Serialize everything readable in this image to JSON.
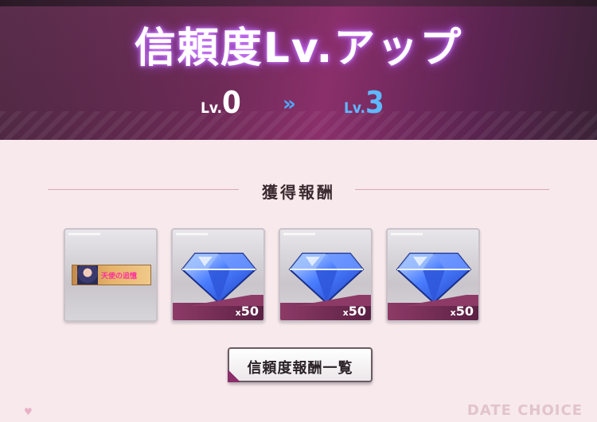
{
  "header": {
    "title": "信頼度Lv.アップ",
    "level_from_prefix": "Lv.",
    "level_from_value": "0",
    "level_to_prefix": "Lv.",
    "level_to_value": "3",
    "arrow_glyph": "»"
  },
  "rewards": {
    "section_title": "獲得報酬",
    "items": [
      {
        "type": "title-card",
        "icon": "title-card-icon",
        "card_text": "天使の追憶"
      },
      {
        "type": "gem",
        "icon": "spirit-gem-icon",
        "qty_prefix": "x",
        "qty": "50"
      },
      {
        "type": "gem",
        "icon": "spirit-gem-icon",
        "qty_prefix": "x",
        "qty": "50"
      },
      {
        "type": "gem",
        "icon": "spirit-gem-icon",
        "qty_prefix": "x",
        "qty": "50"
      }
    ]
  },
  "actions": {
    "reward_list_label": "信頼度報酬一覧"
  },
  "footer": {
    "watermark": "DATE CHOICE"
  },
  "colors": {
    "banner_accent": "#8a2f6a",
    "level_to": "#5fb8ff",
    "background": "#f7e9ec",
    "gem_blue": "#4a7dff"
  }
}
